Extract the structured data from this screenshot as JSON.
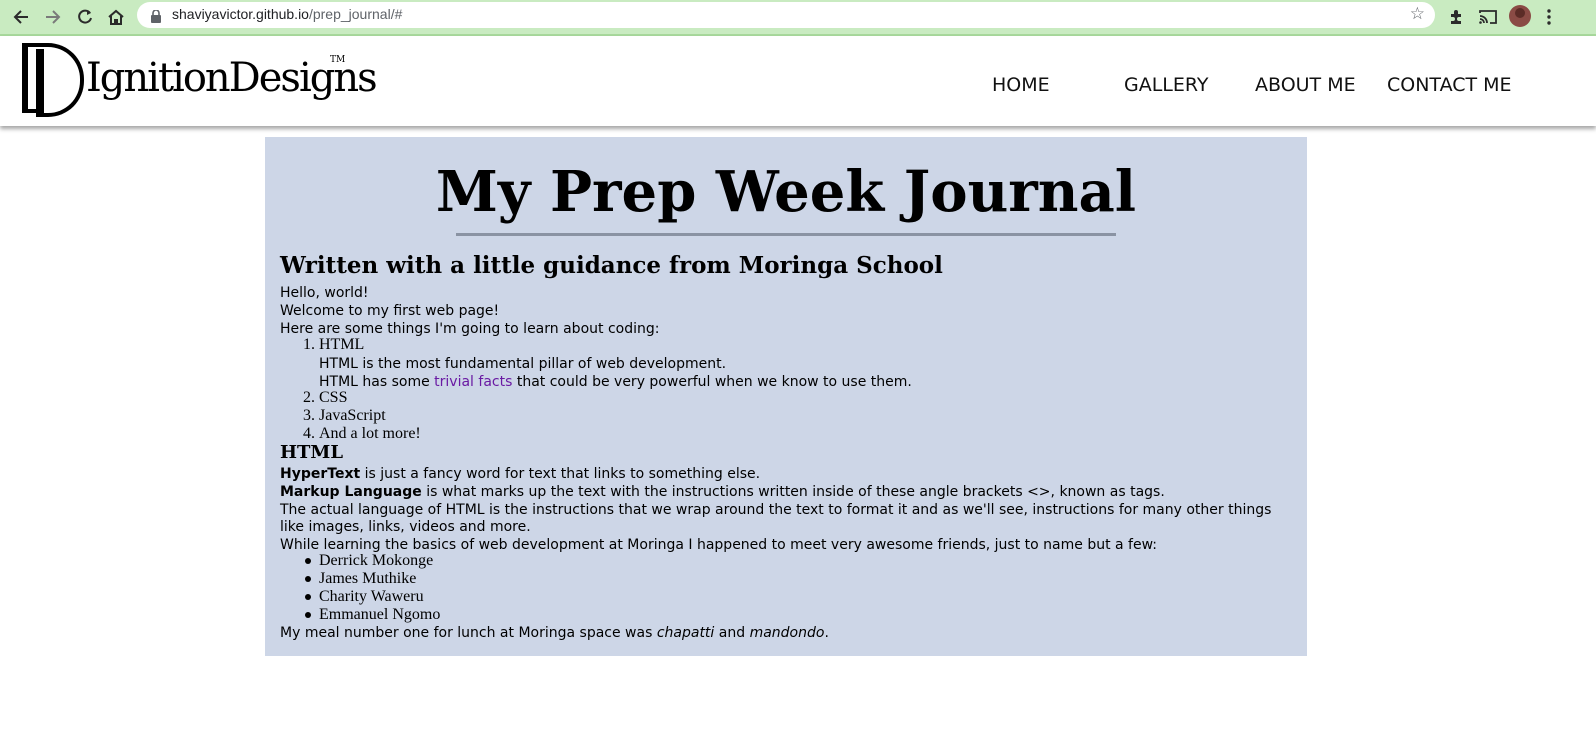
{
  "browser": {
    "url_host": "shaviyavictor.github.io",
    "url_path": "/prep_journal/#",
    "icons": [
      "back-arrow-icon",
      "forward-arrow-icon",
      "reload-icon",
      "home-icon",
      "lock-icon",
      "star-icon",
      "extensions-icon",
      "cast-icon",
      "profile-avatar",
      "menu-dots-icon"
    ]
  },
  "header": {
    "logo_text": "IgnitionDesigns",
    "logo_tm": "TM",
    "nav": [
      "HOME",
      "GALLERY",
      "ABOUT ME",
      "CONTACT ME"
    ]
  },
  "journal": {
    "title": "My Prep Week Journal",
    "subtitle": "Written with a little guidance from Moringa School",
    "intro": [
      "Hello, world!",
      "Welcome to my first web page!",
      "Here are some things I'm going to learn about coding:"
    ],
    "learn_list": {
      "item1": "HTML",
      "item1_desc": "HTML is the most fundamental pillar of web development.",
      "item1_facts_before": "HTML has some ",
      "item1_facts_link": "trivial facts",
      "item1_facts_after": " that could be very powerful when we know to use them.",
      "item2": "CSS",
      "item3": "JavaScript",
      "item4": "And a lot more!"
    },
    "html_heading": "HTML",
    "hypertext_term": "HyperText",
    "hypertext_desc": " is just a fancy word for text that links to something else.",
    "markup_term": "Markup Language",
    "markup_desc": " is what marks up the text with the instructions written inside of these angle brackets <>, known as tags.",
    "actual_lang_1": "The actual language of HTML is the instructions that we wrap around the text to format it and as we'll see, instructions for many other things",
    "actual_lang_2": "like images, links, videos and more.",
    "friends_intro": "While learning the basics of web development at Moringa I happened to meet very awesome friends, just to name but a few:",
    "friends": [
      "Derrick Mokonge",
      "James Muthike",
      "Charity Waweru",
      "Emmanuel Ngomo"
    ],
    "meal_before": "My meal number one for lunch at Moringa space was ",
    "meal_item1": "chapatti",
    "meal_and": " and ",
    "meal_item2": "mandondo",
    "meal_end": "."
  }
}
